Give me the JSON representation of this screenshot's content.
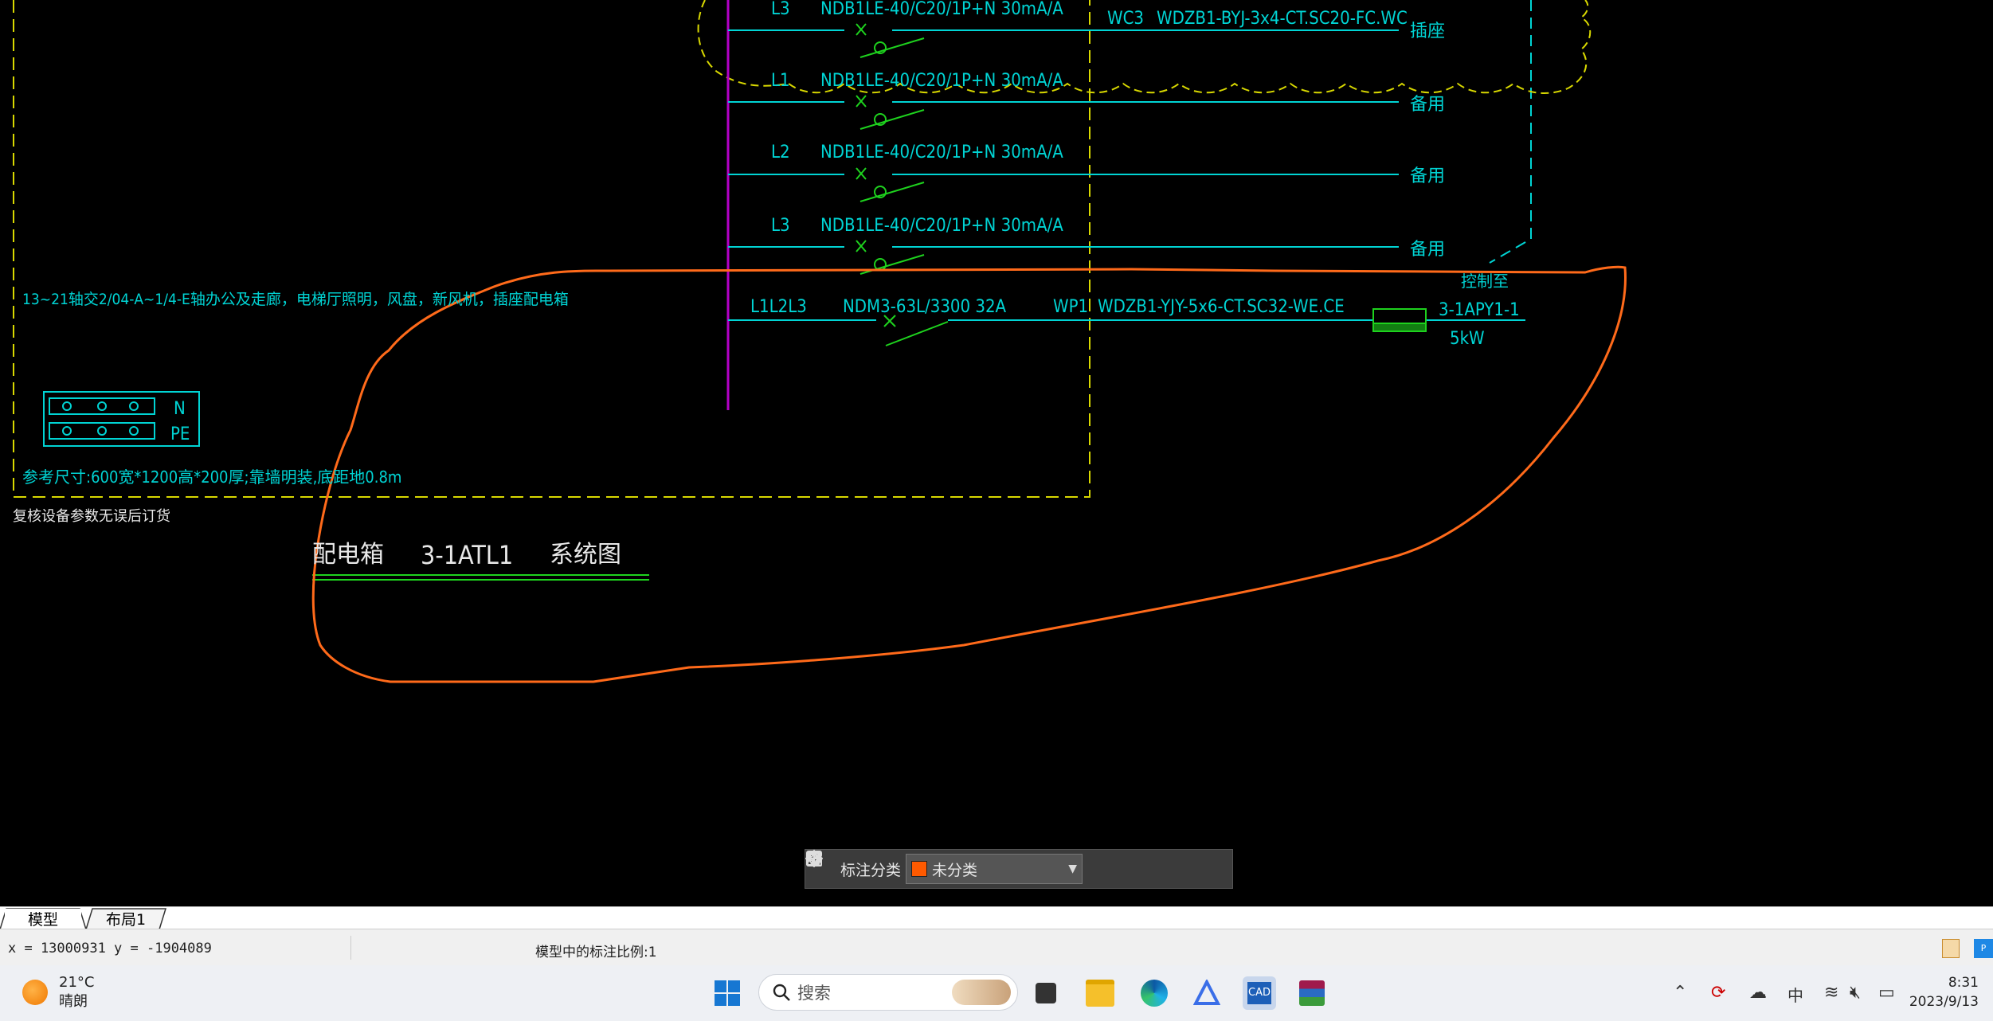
{
  "drawing": {
    "circuits": [
      {
        "phase": "L3",
        "breaker": "NDB1LE-40/C20/1P+N 30mA/A",
        "cable_id": "WC3",
        "cable": "WDZB1-BYJ-3x4-CT.SC20-FC.WC",
        "load": "插座"
      },
      {
        "phase": "L1",
        "breaker": "NDB1LE-40/C20/1P+N 30mA/A",
        "load": "备用"
      },
      {
        "phase": "L2",
        "breaker": "NDB1LE-40/C20/1P+N 30mA/A",
        "load": "备用"
      },
      {
        "phase": "L3",
        "breaker": "NDB1LE-40/C20/1P+N 30mA/A",
        "load": "备用"
      }
    ],
    "feeder": {
      "phase": "L1L2L3",
      "breaker": "NDM3-63L/3300 32A",
      "cable_id": "WP1",
      "cable": "WDZB1-YJY-5x6-CT.SC32-WE.CE",
      "dest_line1": "控制至",
      "dest_line2": "3-1APY1-1",
      "power": "5kW"
    },
    "note_left": "13~21轴交2/04-A~1/4-E轴办公及走廊，电梯厅照明，风盘，新风机，插座配电箱",
    "terminal_labels": {
      "n": "N",
      "pe": "PE"
    },
    "size_note": "参考尺寸:600宽*1200高*200厚;靠墙明装,底距地0.8m",
    "check_note": "复核设备参数无误后订货",
    "title_part1": "配电箱",
    "title_part2": "3-1ATL1",
    "title_part3": "系统图",
    "colors": {
      "cyan": "#00d4d4",
      "green": "#1ed21e",
      "yellow": "#d8d800",
      "magenta": "#b400c8",
      "markup": "#ff6a1a"
    }
  },
  "annotation_toolbar": {
    "label": "标注分类",
    "category": "未分类",
    "category_color": "#ff5a00",
    "icons": [
      "grid-icon",
      "edit-icon",
      "move-icon",
      "copy-icon",
      "paste-icon"
    ]
  },
  "tabs": [
    {
      "label": "模型",
      "active": true
    },
    {
      "label": "布局1",
      "active": false
    }
  ],
  "status": {
    "coordinates": "x = 13000931  y = -1904089",
    "scale_text": "模型中的标注比例:1"
  },
  "taskbar": {
    "weather_temp": "21°C",
    "weather_desc": "晴朗",
    "search_placeholder": "搜索",
    "ime": "中",
    "time": "8:31",
    "date": "2023/9/13"
  }
}
